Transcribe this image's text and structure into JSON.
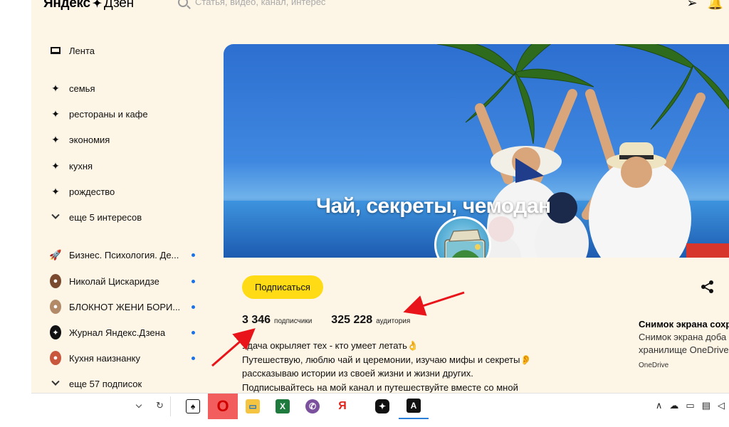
{
  "header": {
    "logo_text": "Яндекс",
    "logo_suffix": "Дзен",
    "search_placeholder": "Статья, видео, канал, интерес"
  },
  "sidebar": {
    "feed": "Лента",
    "interests": [
      "семья",
      "рестораны и кафе",
      "экономия",
      "кухня",
      "рождество"
    ],
    "more_interests": "еще 5 интересов",
    "subscriptions": [
      {
        "label": "Бизнес. Психология. Де...",
        "icon": "rocket-icon"
      },
      {
        "label": "Николай Цискаридзе",
        "icon": "person-avatar"
      },
      {
        "label": "БЛОКНОТ ЖЕНИ БОРИ...",
        "icon": "person-avatar"
      },
      {
        "label": "Журнал Яндекс.Дзена",
        "icon": "zen-star-icon"
      },
      {
        "label": "Кухня наизнанку",
        "icon": "person-avatar"
      }
    ],
    "more_subscriptions": "еще 57 подписок"
  },
  "channel": {
    "title": "Чай, секреты, чемодан",
    "subscribe_label": "Подписаться",
    "subscribers_count": "3 346",
    "subscribers_label": "подписчики",
    "audience_count": "325 228",
    "audience_label": "аудитория",
    "description": [
      "Удача окрыляет тех - кто умеет летать👌",
      "Путешествую, люблю чай и церемонии, изучаю мифы и секреты👂",
      "рассказываю истории из своей жизни и жизни других.",
      "Подписывайтесь на мой канал и путешествуйте вместе со мной"
    ]
  },
  "notification": {
    "title": "Снимок экрана сохр",
    "line1": "Снимок экрана доба",
    "line2": "хранилище OneDrive",
    "source": "OneDrive"
  },
  "colors": {
    "page_bg": "#fdf5e6",
    "subscribe_yellow": "#ffdb15",
    "arrow_red": "#e8141a",
    "dot_blue": "#1a73e8"
  }
}
